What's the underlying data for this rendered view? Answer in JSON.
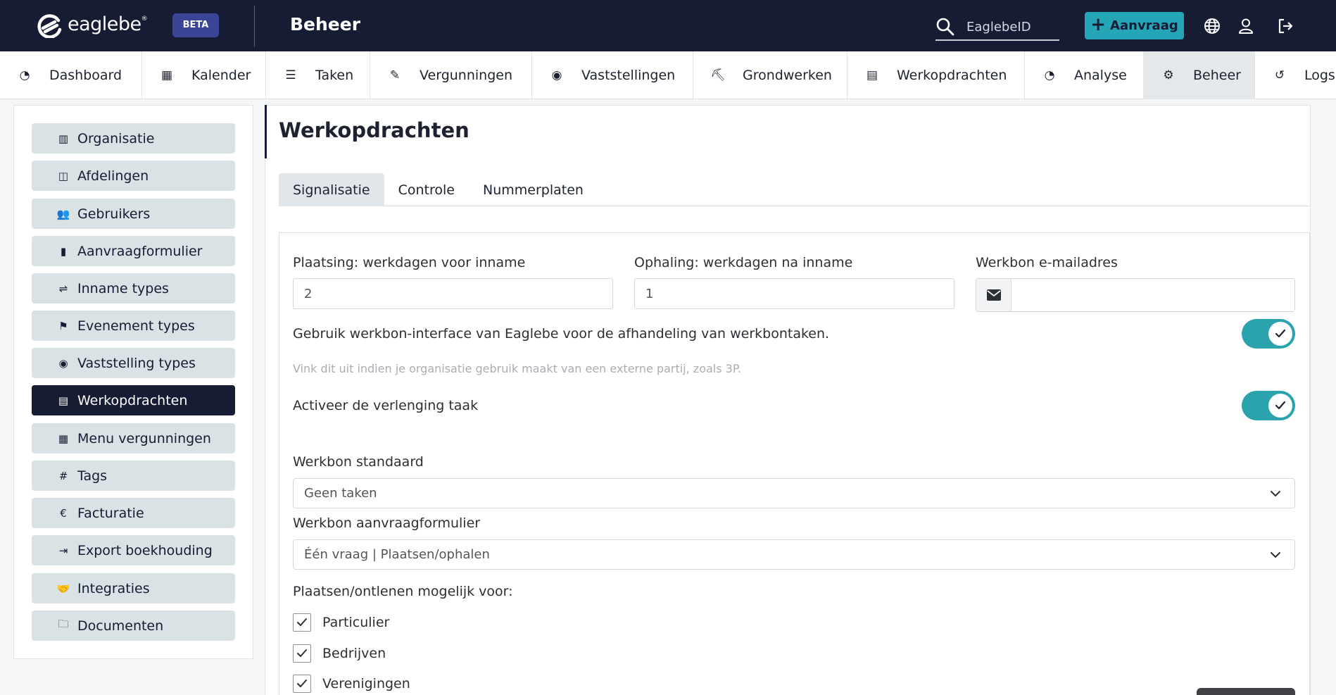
{
  "header": {
    "logo_text": "eaglebe",
    "logo_reg": "®",
    "beta_label": "BETA",
    "page_heading": "Beheer",
    "search_placeholder": "EaglebeID",
    "aanvraag_label": "Aanvraag",
    "icons": [
      "search-icon",
      "globe-icon",
      "user-icon",
      "logout-icon"
    ]
  },
  "nav": {
    "items": [
      {
        "label": "Dashboard",
        "icon": "dashboard-icon",
        "glyph": "◔"
      },
      {
        "label": "Kalender",
        "icon": "calendar-icon",
        "glyph": "▦"
      },
      {
        "label": "Taken",
        "icon": "tasks-icon",
        "glyph": "☰"
      },
      {
        "label": "Vergunningen",
        "icon": "permit-icon",
        "glyph": "✎"
      },
      {
        "label": "Vaststellingen",
        "icon": "eye-icon",
        "glyph": "◉"
      },
      {
        "label": "Grondwerken",
        "icon": "digging-icon",
        "glyph": "⛏"
      },
      {
        "label": "Werkopdrachten",
        "icon": "document-icon",
        "glyph": "▤"
      },
      {
        "label": "Analyse",
        "icon": "gauge-icon",
        "glyph": "◔"
      },
      {
        "label": "Beheer",
        "icon": "gears-icon",
        "glyph": "⚙"
      },
      {
        "label": "Logs",
        "icon": "history-icon",
        "glyph": "↺"
      }
    ],
    "active": "Beheer"
  },
  "sidebar": {
    "items": [
      {
        "label": "Organisatie",
        "icon": "building-icon",
        "glyph": "▥"
      },
      {
        "label": "Afdelingen",
        "icon": "table-icon",
        "glyph": "◫"
      },
      {
        "label": "Gebruikers",
        "icon": "users-icon",
        "glyph": "👥"
      },
      {
        "label": "Aanvraagformulier",
        "icon": "clipboard-icon",
        "glyph": "▮"
      },
      {
        "label": "Inname types",
        "icon": "signs-icon",
        "glyph": "⇌"
      },
      {
        "label": "Evenement types",
        "icon": "flag-checkered-icon",
        "glyph": "⚑"
      },
      {
        "label": "Vaststelling types",
        "icon": "eye-icon",
        "glyph": "◉"
      },
      {
        "label": "Werkopdrachten",
        "icon": "document-icon",
        "glyph": "▤"
      },
      {
        "label": "Menu vergunningen",
        "icon": "grid-icon",
        "glyph": "▦"
      },
      {
        "label": "Tags",
        "icon": "hashtag-icon",
        "glyph": "#"
      },
      {
        "label": "Facturatie",
        "icon": "euro-icon",
        "glyph": "€"
      },
      {
        "label": "Export boekhouding",
        "icon": "file-export-icon",
        "glyph": "⇥"
      },
      {
        "label": "Integraties",
        "icon": "handshake-icon",
        "glyph": "🤝"
      },
      {
        "label": "Documenten",
        "icon": "folder-open-icon",
        "glyph": "🗀"
      }
    ],
    "active": "Werkopdrachten"
  },
  "main": {
    "title": "Werkopdrachten",
    "tabs": [
      "Signalisatie",
      "Controle",
      "Nummerplaten"
    ],
    "active_tab": "Signalisatie",
    "form": {
      "plaatsing_label": "Plaatsing: werkdagen voor inname",
      "plaatsing_value": "2",
      "ophaling_label": "Ophaling: werkdagen na inname",
      "ophaling_value": "1",
      "email_label": "Werkbon e-mailadres",
      "email_value": "",
      "interface_text": "Gebruik werkbon-interface van Eaglebe voor de afhandeling van werkbontaken.",
      "interface_on": true,
      "interface_hint": "Vink dit uit indien je organisatie gebruik maakt van een externe partij, zoals 3P.",
      "verlenging_text": "Activeer de verlenging taak",
      "verlenging_on": true,
      "standaard_label": "Werkbon standaard",
      "standaard_value": "Geen taken",
      "aanvraagformulier_label": "Werkbon aanvraagformulier",
      "aanvraagformulier_value": "Één vraag | Plaatsen/ophalen",
      "plaatsen_label": "Plaatsen/ontlenen mogelijk voor:",
      "checkboxes": [
        {
          "label": "Particulier",
          "checked": true
        },
        {
          "label": "Bedrijven",
          "checked": true
        },
        {
          "label": "Verenigingen",
          "checked": true
        }
      ]
    }
  },
  "colors": {
    "header_bg": "#151c33",
    "accent": "#24a6b6",
    "beta_bg": "#3a4597",
    "sidebar_btn": "#d9e3e5",
    "toggle": "#2aa3ad"
  }
}
